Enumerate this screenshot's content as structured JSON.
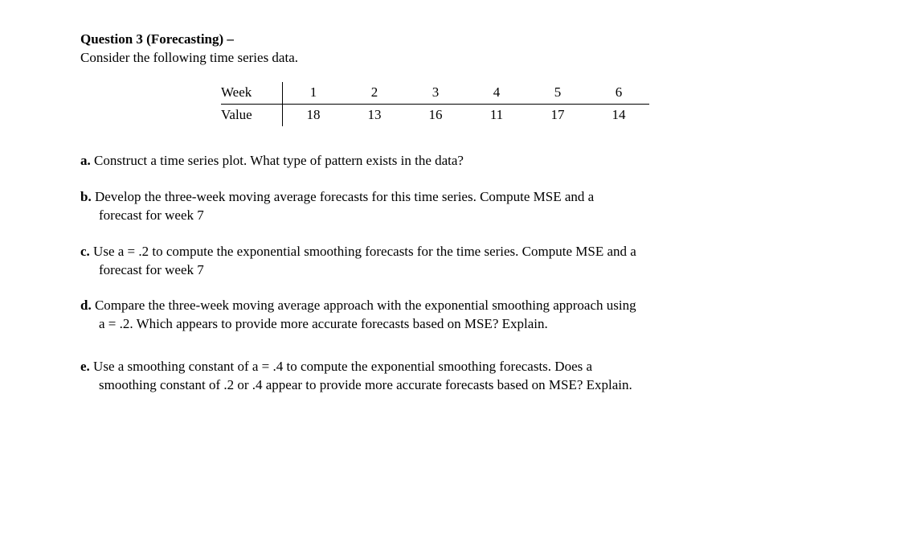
{
  "header": {
    "title": "Question 3 (Forecasting) –",
    "intro": "Consider the following time series data."
  },
  "table": {
    "row1label": "Week",
    "row2label": "Value",
    "weeks": [
      "1",
      "2",
      "3",
      "4",
      "5",
      "6"
    ],
    "values": [
      "18",
      "13",
      "16",
      "11",
      "17",
      "14"
    ]
  },
  "parts": {
    "a": {
      "label": "a.",
      "text": " Construct a time series plot. What type of pattern exists in the data?"
    },
    "b": {
      "label": "b.",
      "line1": " Develop the three-week moving average forecasts for this time series. Compute MSE and a",
      "line2": "forecast for week 7"
    },
    "c": {
      "label": "c.",
      "line1": " Use a = .2 to compute the exponential smoothing forecasts for the time series. Compute MSE and a",
      "line2": "forecast for week 7"
    },
    "d": {
      "label": "d.",
      "line1": " Compare the three-week moving average approach with the exponential smoothing approach using",
      "line2": "a = .2. Which appears to provide more accurate forecasts based on MSE? Explain."
    },
    "e": {
      "label": "e.",
      "line1": " Use a smoothing constant of a = .4 to compute the exponential smoothing forecasts. Does a",
      "line2": "smoothing constant of .2 or .4 appear to provide more accurate forecasts based on MSE? Explain."
    }
  }
}
